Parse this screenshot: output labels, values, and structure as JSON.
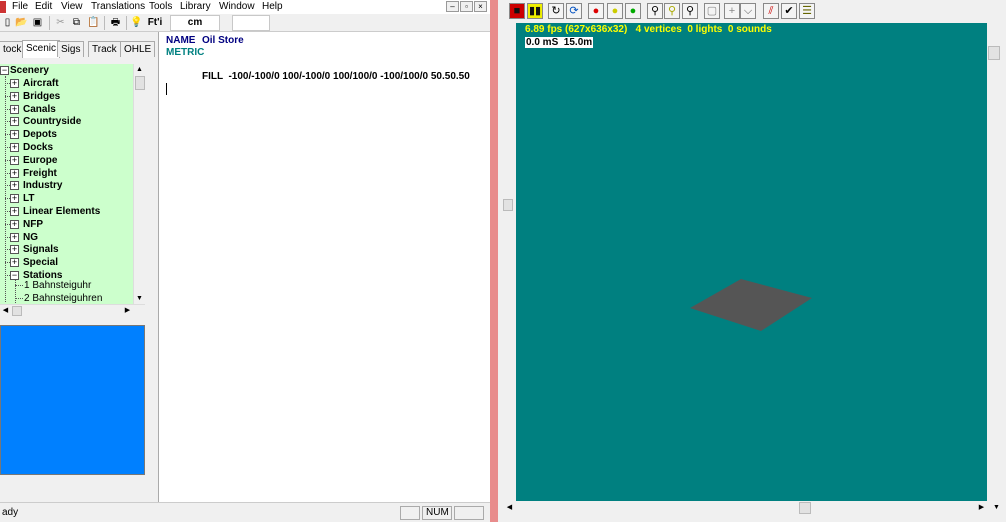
{
  "menu": {
    "items": [
      "File",
      "Edit",
      "View",
      "Translations",
      "Tools",
      "Library",
      "Window",
      "Help"
    ],
    "win_min": "–",
    "win_restore": "▫",
    "win_close": "×"
  },
  "toolbar": {
    "icons": [
      "new-icon",
      "open-icon",
      "save-icon",
      "cut-icon",
      "copy-icon",
      "paste-icon",
      "print-icon",
      "help-icon"
    ],
    "units_label": "Ft'i",
    "units_value": "cm"
  },
  "tabs": [
    "tock",
    "Scenic",
    "Sigs",
    "Track",
    "OHLE"
  ],
  "active_tab": "Scenic",
  "tree": {
    "root": "Scenery",
    "categories": [
      "Aircraft",
      "Bridges",
      "Canals",
      "Countryside",
      "Depots",
      "Docks",
      "Europe",
      "Freight",
      "Industry",
      "LT",
      "Linear Elements",
      "NFP",
      "NG",
      "Signals",
      "Special",
      "Stations"
    ],
    "leaves": [
      "1 Bahnsteiguhr",
      "2 Bahnsteiguhren"
    ]
  },
  "editor": {
    "line1_key": "NAME",
    "line1_val": "Oil Store",
    "line2": "METRIC",
    "line3": "FILL  -100/-100/0 100/-100/0 100/100/0 -100/100/0 50.50.50"
  },
  "status": {
    "text": "ady",
    "num": "NUM"
  },
  "viewer": {
    "hud_stats": "6.89 fps (627x636x32)   4 vertices  0 lights  0 sounds",
    "hud_time": "0.0 mS  15.0m",
    "bg_color": "#008080",
    "stats_color": "#ffff00",
    "object_color": "#555555",
    "tools": [
      "stop-icon",
      "pause-icon",
      "rotate-icon",
      "refresh-icon",
      "light-red-icon",
      "light-yellow-icon",
      "light-green-icon",
      "pin-icon",
      "pin-yellow-icon",
      "pin-select-icon",
      "box-icon",
      "cross-icon",
      "vertex-icon",
      "graph-icon",
      "check-icon",
      "list-icon"
    ]
  }
}
